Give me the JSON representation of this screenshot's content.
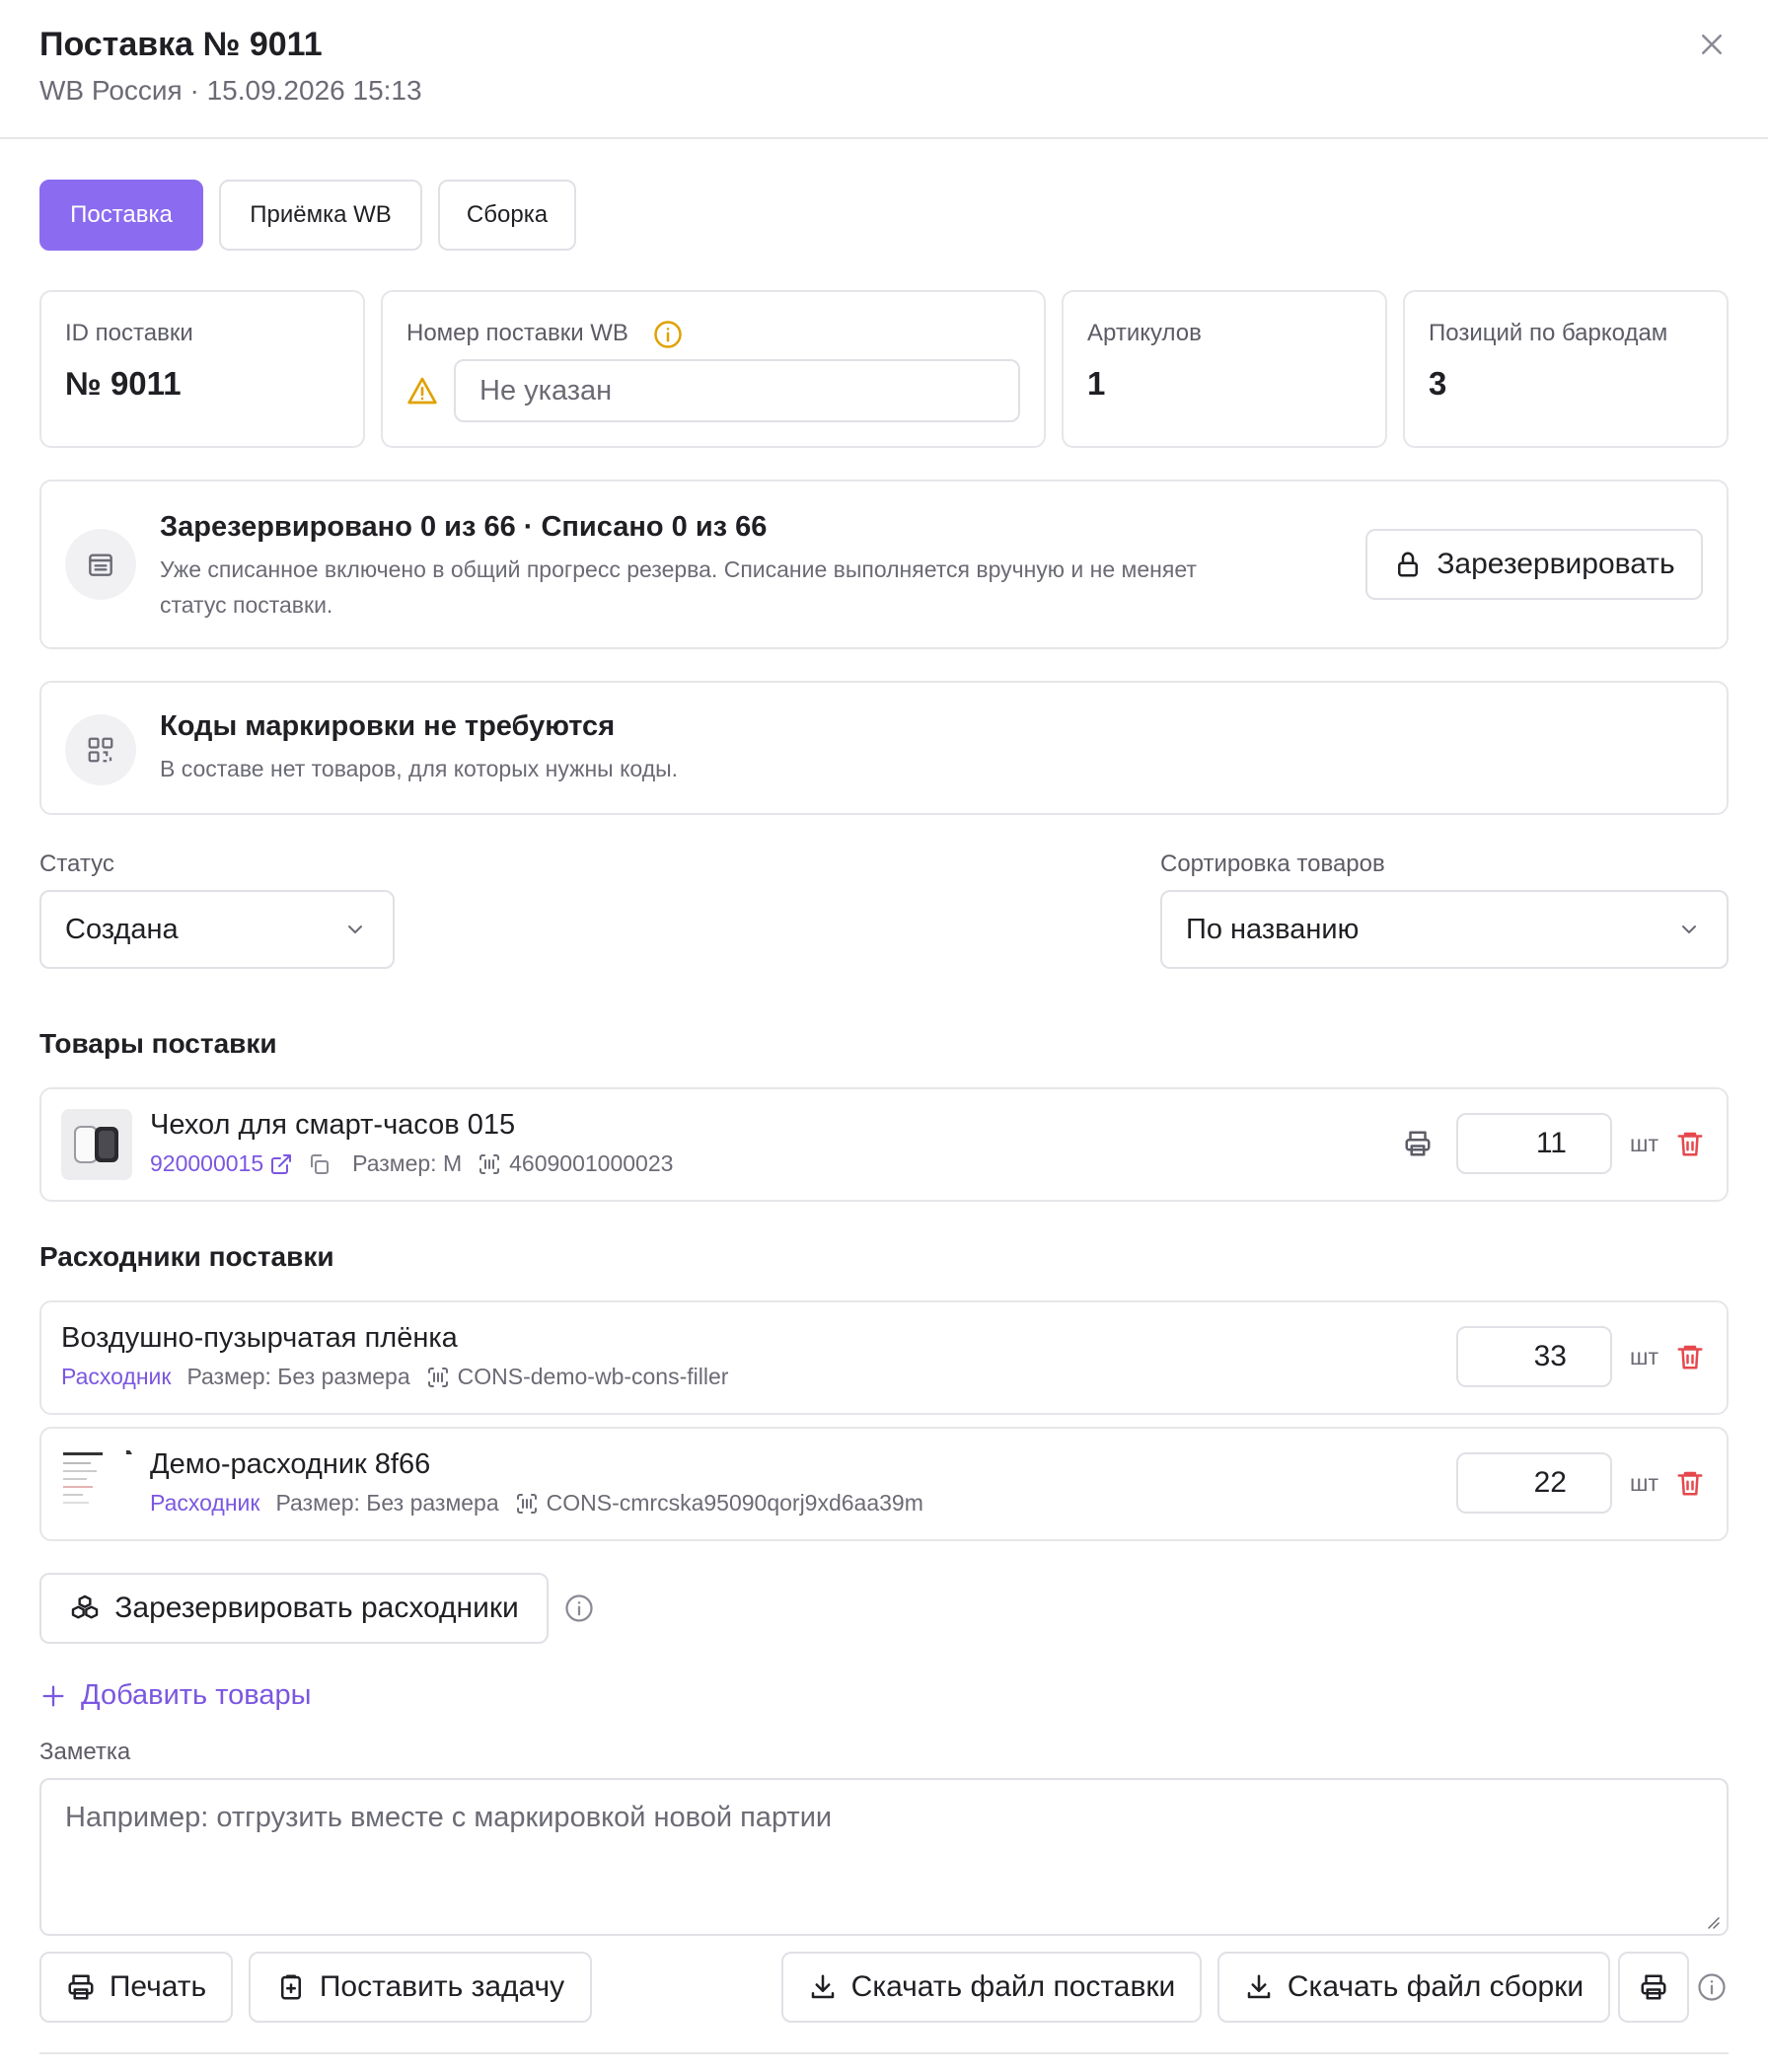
{
  "header": {
    "title": "Поставка № 9011",
    "subtitle": "WB Россия · 15.09.2026 15:13"
  },
  "tabs": [
    "Поставка",
    "Приёмка WB",
    "Сборка"
  ],
  "stats": {
    "id_label": "ID поставки",
    "id_value": "№ 9011",
    "wb_label": "Номер поставки WB",
    "wb_placeholder": "Не указан",
    "articles_label": "Артикулов",
    "articles_value": "1",
    "positions_label": "Позиций по баркодам",
    "positions_value": "3"
  },
  "reserve": {
    "title": "Зарезервировано 0 из 66 · Списано 0 из 66",
    "description_line1": "Уже списанное включено в общий прогресс резерва. Списание выполняется вручную и не меняет",
    "description_line2": "статус поставки.",
    "button": "Зарезервировать"
  },
  "marking": {
    "title": "Коды маркировки не требуются",
    "description": "В составе нет товаров, для которых нужны коды."
  },
  "status": {
    "label": "Статус",
    "value": "Создана"
  },
  "sorting": {
    "label": "Сортировка товаров",
    "value": "По названию"
  },
  "products": {
    "heading": "Товары поставки",
    "items": [
      {
        "name": "Чехол для смарт-часов 015",
        "article": "920000015",
        "size": "Размер: M",
        "barcode": "4609001000023",
        "qty": "11",
        "unit": "шт"
      }
    ]
  },
  "consumables": {
    "heading": "Расходники поставки",
    "items": [
      {
        "name": "Воздушно-пузырчатая плёнка",
        "tag": "Расходник",
        "size": "Размер: Без размера",
        "barcode": "CONS-demo-wb-cons-filler",
        "qty": "33",
        "unit": "шт"
      },
      {
        "name": "Демо-расходник 8f66",
        "tag": "Расходник",
        "size": "Размер: Без размера",
        "barcode": "CONS-cmrcska95090qorj9xd6aa39m",
        "qty": "22",
        "unit": "шт"
      }
    ],
    "reserve_button": "Зарезервировать расходники"
  },
  "add_goods": "Добавить товары",
  "note": {
    "label": "Заметка",
    "placeholder": "Например: отгрузить вместе с маркировкой новой партии"
  },
  "footer": {
    "print": "Печать",
    "task": "Поставить задачу",
    "download_supply": "Скачать файл поставки",
    "download_assembly": "Скачать файл сборки"
  },
  "colors": {
    "accent": "#8b6cf0",
    "link": "#7b57e0",
    "danger": "#e5484d",
    "warning": "#e0a100"
  }
}
